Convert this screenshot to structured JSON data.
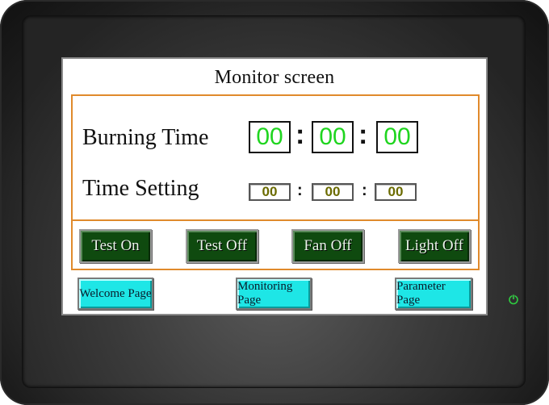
{
  "screen": {
    "title": "Monitor screen"
  },
  "burning_time": {
    "label": "Burning Time",
    "hours": "00",
    "minutes": "00",
    "seconds": "00",
    "separator": ":"
  },
  "time_setting": {
    "label": "Time Setting",
    "hours": "00",
    "minutes": "00",
    "seconds": "00",
    "separator": ":"
  },
  "control_buttons": [
    {
      "label": "Test On"
    },
    {
      "label": "Test Off"
    },
    {
      "label": "Fan Off"
    },
    {
      "label": "Light Off"
    }
  ],
  "nav_buttons": [
    {
      "label": "Welcome Page"
    },
    {
      "label": "Monitoring Page"
    },
    {
      "label": "Parameter Page"
    }
  ],
  "colors": {
    "display_digits": "#1fd51f",
    "setting_digits": "#6b6b00",
    "panel_border": "#e08a2c",
    "control_button": "#0f4a0f",
    "nav_button": "#1ee6e6"
  },
  "icons": {
    "power": "power-icon"
  }
}
